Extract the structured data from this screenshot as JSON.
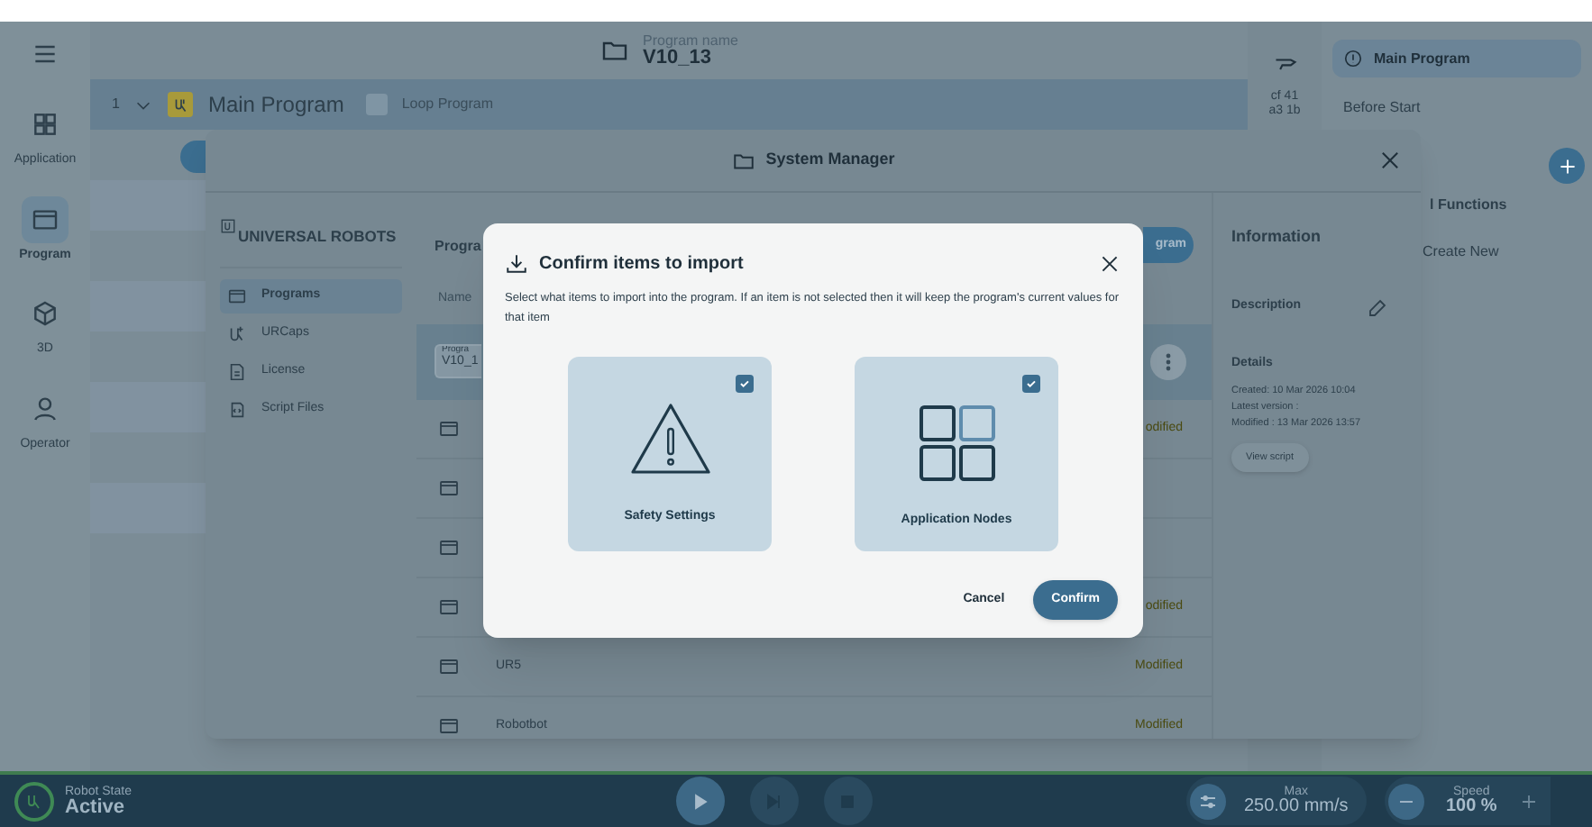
{
  "nav_rail": {
    "items": [
      {
        "kind": "apps",
        "label": "Application",
        "selected": false
      },
      {
        "kind": "program",
        "label": "Program",
        "selected": true
      },
      {
        "kind": "cube",
        "label": "3D",
        "selected": false
      },
      {
        "kind": "person",
        "label": "Operator",
        "selected": false
      }
    ]
  },
  "program_header": {
    "label": "Program name",
    "value": "V10_13"
  },
  "program_tree": {
    "line": "1",
    "title": "Main Program",
    "expanded": true,
    "loop": {
      "label": "Loop Program",
      "checked": false
    }
  },
  "checksum": {
    "lines": [
      "cf 41",
      "a3 1b"
    ]
  },
  "side_panel": {
    "items": [
      {
        "label": "Main Program",
        "selected": true
      },
      {
        "label": "Before Start",
        "selected": false
      }
    ],
    "section": "l Functions",
    "create": "Create New"
  },
  "system_manager": {
    "title": "System Manager",
    "brand": "UNIVERSAL ROBOTS",
    "nav": [
      {
        "kind": "programs",
        "label": "Programs",
        "selected": true
      },
      {
        "kind": "urcaps",
        "label": "URCaps",
        "selected": false
      },
      {
        "kind": "license",
        "label": "License",
        "selected": false
      },
      {
        "kind": "script",
        "label": "Script Files",
        "selected": false
      }
    ],
    "heading": "Progra",
    "action": "gram",
    "column": "Name",
    "selected_row": {
      "label": "Progra",
      "value": "V10_1"
    },
    "rows": [
      {
        "kind": "program",
        "status": "odified"
      },
      {
        "kind": "program"
      },
      {
        "kind": "program"
      },
      {
        "kind": "program",
        "status": "odified"
      },
      {
        "kind": "program",
        "name": "UR5",
        "status": "Modified"
      },
      {
        "kind": "program",
        "name": "Robotbot",
        "status": "Modified"
      }
    ],
    "information": {
      "title": "Information",
      "description_label": "Description",
      "details_label": "Details",
      "details": [
        "Created: 10 Mar 2026 10:04",
        "Latest version :",
        "Modified : 13 Mar 2026 13:57"
      ],
      "view_script": "View script"
    }
  },
  "import_dialog": {
    "title": "Confirm items to import",
    "message": "Select what items to import into the program. If an item is not selected then it will keep the program's current values for that item",
    "items": [
      {
        "kind": "safety",
        "label": "Safety Settings",
        "checked": true
      },
      {
        "kind": "nodes",
        "label": "Application Nodes",
        "checked": true
      }
    ],
    "cancel": "Cancel",
    "confirm": "Confirm"
  },
  "status_bar": {
    "state_label": "Robot State",
    "state": "Active",
    "max_label": "Max",
    "max_value": "250.00 mm/s",
    "speed_label": "Speed",
    "speed_value": "100 %"
  }
}
